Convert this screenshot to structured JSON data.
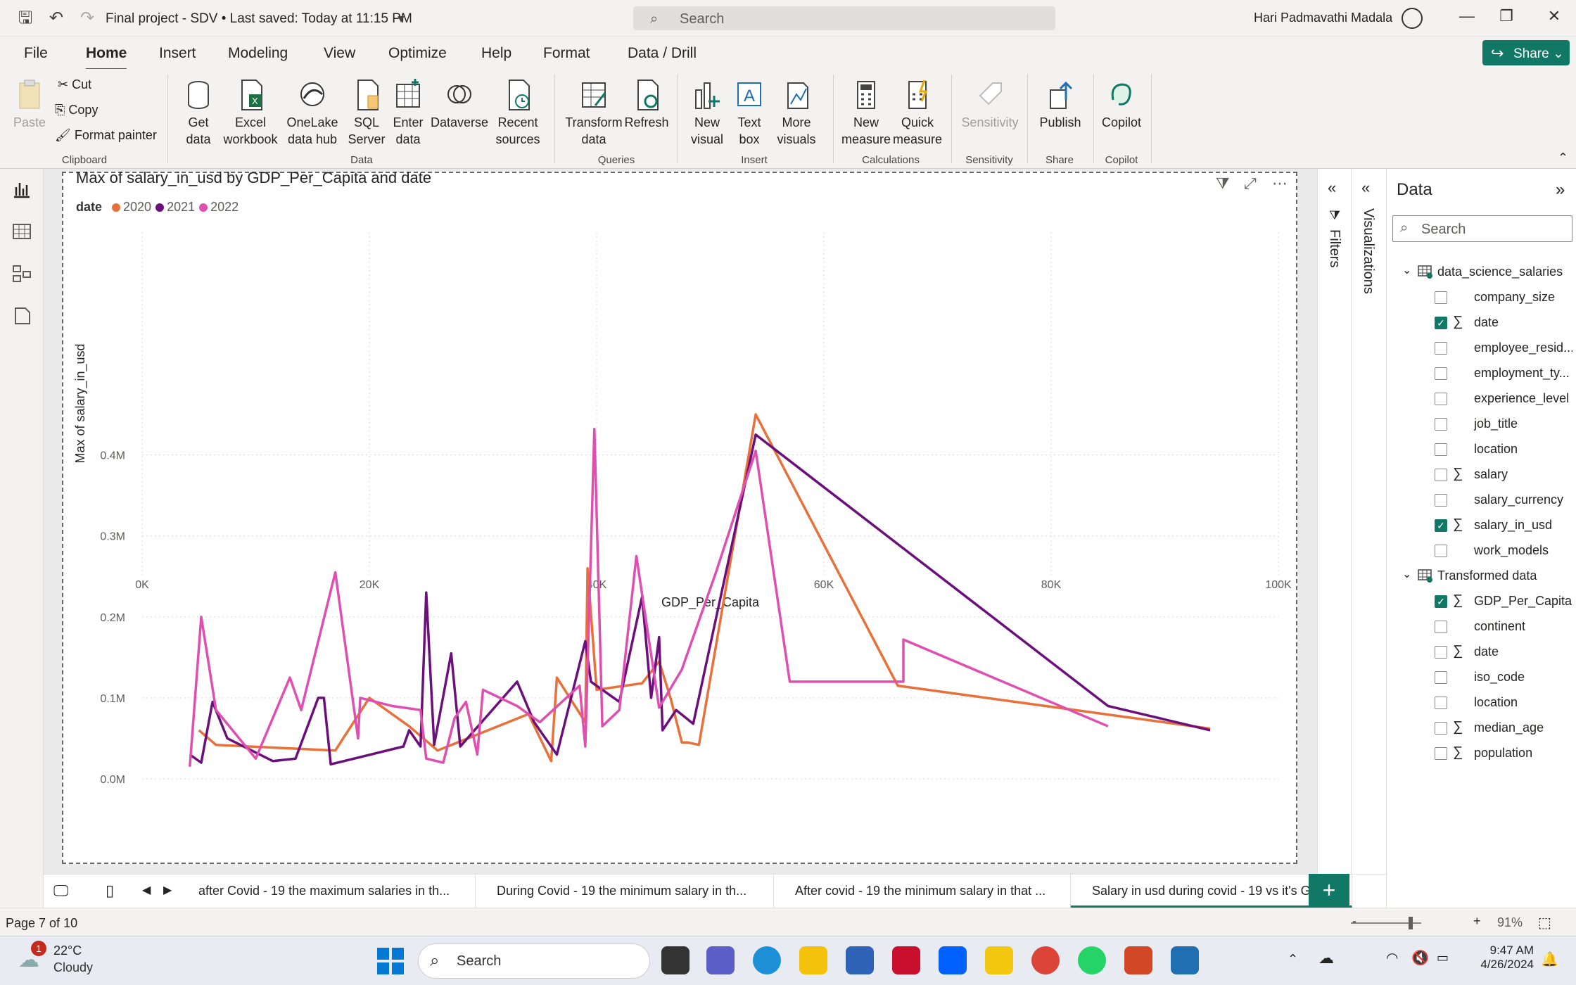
{
  "titlebar": {
    "doc_title": "Final project - SDV • Last saved: Today at 11:15 PM",
    "search_placeholder": "Search",
    "user": "Hari Padmavathi Madala"
  },
  "tabs": [
    "File",
    "Home",
    "Insert",
    "Modeling",
    "View",
    "Optimize",
    "Help",
    "Format",
    "Data / Drill"
  ],
  "active_tab": "Home",
  "share_label": "Share",
  "ribbon": {
    "clipboard": {
      "paste": "Paste",
      "cut": "Cut",
      "copy": "Copy",
      "format_painter": "Format painter",
      "label": "Clipboard"
    },
    "data": {
      "get_data": "Get data",
      "excel": "Excel workbook",
      "onelake": "OneLake data hub",
      "sql": "SQL Server",
      "enter": "Enter data",
      "dataverse": "Dataverse",
      "recent": "Recent sources",
      "label": "Data"
    },
    "queries": {
      "transform": "Transform data",
      "refresh": "Refresh",
      "label": "Queries"
    },
    "insert": {
      "new_visual": "New visual",
      "text_box": "Text box",
      "more_visuals": "More visuals",
      "label": "Insert"
    },
    "calculations": {
      "new_measure": "New measure",
      "quick_measure": "Quick measure",
      "label": "Calculations"
    },
    "sensitivity": {
      "sensitivity": "Sensitivity",
      "label": "Sensitivity"
    },
    "share": {
      "publish": "Publish",
      "label": "Share"
    },
    "copilot": {
      "copilot": "Copilot",
      "label": "Copilot"
    }
  },
  "colors": {
    "accent": "#117865",
    "s2020": "#e8703a",
    "s2021": "#6b0f7a",
    "s2022": "#de4fb0"
  },
  "visual": {
    "title": "Max of salary_in_usd by GDP_Per_Capita and date",
    "legend_title": "date"
  },
  "chart_data": {
    "type": "line",
    "title": "Max of salary_in_usd by GDP_Per_Capita and date",
    "xlabel": "GDP_Per_Capita",
    "ylabel": "Max of salary_in_usd",
    "xlim": [
      0,
      100000
    ],
    "ylim": [
      0,
      450000
    ],
    "x_ticks": [
      "0K",
      "20K",
      "40K",
      "60K",
      "80K",
      "100K"
    ],
    "y_ticks": [
      "0.0M",
      "0.1M",
      "0.2M",
      "0.3M",
      "0.4M"
    ],
    "legend_position": "top-left",
    "grid": true,
    "series": [
      {
        "name": "2020",
        "color": "#e8703a",
        "points": [
          [
            5000,
            60000
          ],
          [
            6500,
            42000
          ],
          [
            17000,
            35000
          ],
          [
            20000,
            100000
          ],
          [
            23500,
            65000
          ],
          [
            26000,
            35000
          ],
          [
            34000,
            80000
          ],
          [
            36000,
            22000
          ],
          [
            36500,
            125000
          ],
          [
            39000,
            70000
          ],
          [
            39200,
            260000
          ],
          [
            40000,
            110000
          ],
          [
            44000,
            118000
          ],
          [
            45500,
            145000
          ],
          [
            46500,
            100000
          ],
          [
            47500,
            45000
          ],
          [
            48000,
            45000
          ],
          [
            49000,
            42000
          ],
          [
            54000,
            450000
          ],
          [
            66500,
            115000
          ],
          [
            94000,
            62000
          ]
        ]
      },
      {
        "name": "2021",
        "color": "#6b0f7a",
        "points": [
          [
            4200,
            30000
          ],
          [
            5200,
            20000
          ],
          [
            6200,
            95000
          ],
          [
            7500,
            50000
          ],
          [
            11500,
            22000
          ],
          [
            13500,
            25000
          ],
          [
            15500,
            100000
          ],
          [
            16000,
            100000
          ],
          [
            16600,
            18000
          ],
          [
            23000,
            40000
          ],
          [
            23500,
            60000
          ],
          [
            24500,
            40000
          ],
          [
            25000,
            230000
          ],
          [
            25700,
            42000
          ],
          [
            27200,
            155000
          ],
          [
            28000,
            40000
          ],
          [
            33000,
            120000
          ],
          [
            34500,
            70000
          ],
          [
            36500,
            30000
          ],
          [
            39000,
            170000
          ],
          [
            39500,
            120000
          ],
          [
            42000,
            95000
          ],
          [
            44000,
            225000
          ],
          [
            44800,
            100000
          ],
          [
            45500,
            175000
          ],
          [
            45800,
            60000
          ],
          [
            47000,
            85000
          ],
          [
            48500,
            68000
          ],
          [
            54000,
            425000
          ],
          [
            85000,
            90000
          ],
          [
            94000,
            60000
          ]
        ]
      },
      {
        "name": "2022",
        "color": "#de4fb0",
        "points": [
          [
            4200,
            15000
          ],
          [
            5200,
            200000
          ],
          [
            6500,
            85000
          ],
          [
            10000,
            25000
          ],
          [
            13000,
            125000
          ],
          [
            14000,
            85000
          ],
          [
            17000,
            255000
          ],
          [
            19000,
            50000
          ],
          [
            19200,
            100000
          ],
          [
            22000,
            90000
          ],
          [
            24500,
            85000
          ],
          [
            25000,
            25000
          ],
          [
            26500,
            20000
          ],
          [
            27500,
            75000
          ],
          [
            28500,
            95000
          ],
          [
            29500,
            30000
          ],
          [
            30000,
            110000
          ],
          [
            33000,
            90000
          ],
          [
            35000,
            70000
          ],
          [
            38500,
            115000
          ],
          [
            39000,
            40000
          ],
          [
            39800,
            432000
          ],
          [
            40500,
            65000
          ],
          [
            42000,
            85000
          ],
          [
            43500,
            275000
          ],
          [
            45500,
            88000
          ],
          [
            47500,
            135000
          ],
          [
            50500,
            255000
          ],
          [
            54000,
            405000
          ],
          [
            57000,
            120000
          ],
          [
            67000,
            120000
          ],
          [
            67000,
            172000
          ],
          [
            85000,
            65000
          ]
        ]
      }
    ]
  },
  "panes": {
    "filters": "Filters",
    "visualizations": "Visualizations"
  },
  "data_pane": {
    "title": "Data",
    "search_placeholder": "Search",
    "tables": [
      {
        "name": "data_science_salaries",
        "fields": [
          {
            "name": "company_size",
            "checked": false,
            "sigma": false
          },
          {
            "name": "date",
            "checked": true,
            "sigma": true
          },
          {
            "name": "employee_resid...",
            "checked": false,
            "sigma": false
          },
          {
            "name": "employment_ty...",
            "checked": false,
            "sigma": false
          },
          {
            "name": "experience_level",
            "checked": false,
            "sigma": false
          },
          {
            "name": "job_title",
            "checked": false,
            "sigma": false
          },
          {
            "name": "location",
            "checked": false,
            "sigma": false
          },
          {
            "name": "salary",
            "checked": false,
            "sigma": true
          },
          {
            "name": "salary_currency",
            "checked": false,
            "sigma": false
          },
          {
            "name": "salary_in_usd",
            "checked": true,
            "sigma": true
          },
          {
            "name": "work_models",
            "checked": false,
            "sigma": false
          }
        ]
      },
      {
        "name": "Transformed data",
        "fields": [
          {
            "name": "GDP_Per_Capita",
            "checked": true,
            "sigma": true
          },
          {
            "name": "continent",
            "checked": false,
            "sigma": false
          },
          {
            "name": "date",
            "checked": false,
            "sigma": true
          },
          {
            "name": "iso_code",
            "checked": false,
            "sigma": false
          },
          {
            "name": "location",
            "checked": false,
            "sigma": false
          },
          {
            "name": "median_age",
            "checked": false,
            "sigma": true
          },
          {
            "name": "population",
            "checked": false,
            "sigma": true
          }
        ]
      }
    ]
  },
  "page_tabs": [
    "after Covid - 19 the maximum salaries in th...",
    "During Covid - 19 the minimum salary in th...",
    "After covid - 19 the minimum salary in that ...",
    "Salary in usd during covid - 19 vs it's G"
  ],
  "status": {
    "page_info": "Page 7 of 10",
    "zoom": "91%"
  },
  "taskbar": {
    "temp": "22°C",
    "condition": "Cloudy",
    "badge": "1",
    "search": "Search",
    "time": "9:47 AM",
    "date": "4/26/2024"
  }
}
